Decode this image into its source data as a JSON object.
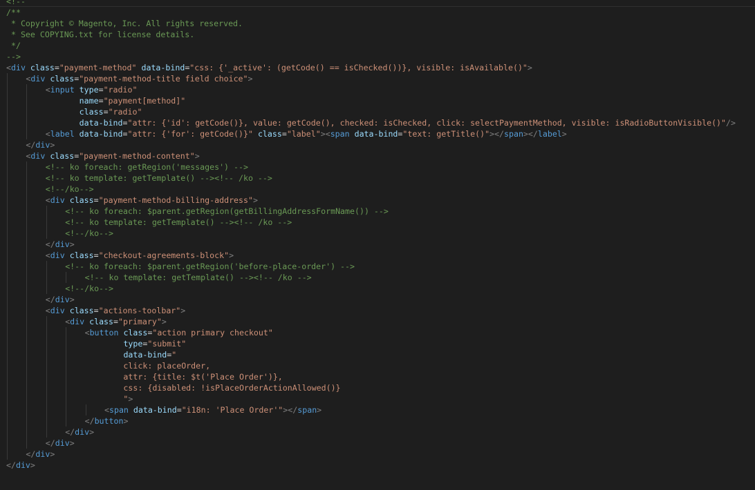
{
  "editor": {
    "colors": {
      "background": "#1e1e1e",
      "comment": "#6a9955",
      "tag": "#569cd6",
      "attribute": "#9cdcfe",
      "string": "#ce9178",
      "punctuation": "#808080",
      "text": "#d4d4d4"
    },
    "lines": [
      {
        "indent": 0,
        "tokens": [
          [
            "c",
            "<!--"
          ]
        ]
      },
      {
        "indent": 0,
        "tokens": [
          [
            "c",
            "/**"
          ]
        ]
      },
      {
        "indent": 0,
        "tokens": [
          [
            "c",
            " * Copyright © Magento, Inc. All rights reserved."
          ]
        ]
      },
      {
        "indent": 0,
        "tokens": [
          [
            "c",
            " * See COPYING.txt for license details."
          ]
        ]
      },
      {
        "indent": 0,
        "tokens": [
          [
            "c",
            " */"
          ]
        ]
      },
      {
        "indent": 0,
        "tokens": [
          [
            "c",
            "-->"
          ]
        ]
      },
      {
        "indent": 0,
        "tokens": [
          [
            "p",
            "<"
          ],
          [
            "t",
            "div"
          ],
          [
            "x",
            " "
          ],
          [
            "a",
            "class"
          ],
          [
            "x",
            "="
          ],
          [
            "s",
            "\"payment-method\""
          ],
          [
            "x",
            " "
          ],
          [
            "a",
            "data-bind"
          ],
          [
            "x",
            "="
          ],
          [
            "s",
            "\"css: {'_active': (getCode() == isChecked())}, visible: isAvailable()\""
          ],
          [
            "p",
            ">"
          ]
        ]
      },
      {
        "indent": 1,
        "tokens": [
          [
            "p",
            "<"
          ],
          [
            "t",
            "div"
          ],
          [
            "x",
            " "
          ],
          [
            "a",
            "class"
          ],
          [
            "x",
            "="
          ],
          [
            "s",
            "\"payment-method-title field choice\""
          ],
          [
            "p",
            ">"
          ]
        ]
      },
      {
        "indent": 2,
        "tokens": [
          [
            "p",
            "<"
          ],
          [
            "t",
            "input"
          ],
          [
            "x",
            " "
          ],
          [
            "a",
            "type"
          ],
          [
            "x",
            "="
          ],
          [
            "s",
            "\"radio\""
          ]
        ]
      },
      {
        "indent": 2,
        "tokens": [
          [
            "x",
            "       "
          ],
          [
            "a",
            "name"
          ],
          [
            "x",
            "="
          ],
          [
            "s",
            "\"payment[method]\""
          ]
        ]
      },
      {
        "indent": 2,
        "tokens": [
          [
            "x",
            "       "
          ],
          [
            "a",
            "class"
          ],
          [
            "x",
            "="
          ],
          [
            "s",
            "\"radio\""
          ]
        ]
      },
      {
        "indent": 2,
        "tokens": [
          [
            "x",
            "       "
          ],
          [
            "a",
            "data-bind"
          ],
          [
            "x",
            "="
          ],
          [
            "s",
            "\"attr: {'id': getCode()}, value: getCode(), checked: isChecked, click: selectPaymentMethod, visible: isRadioButtonVisible()\""
          ],
          [
            "p",
            "/>"
          ]
        ]
      },
      {
        "indent": 2,
        "tokens": [
          [
            "p",
            "<"
          ],
          [
            "t",
            "label"
          ],
          [
            "x",
            " "
          ],
          [
            "a",
            "data-bind"
          ],
          [
            "x",
            "="
          ],
          [
            "s",
            "\"attr: {'for': getCode()}\""
          ],
          [
            "x",
            " "
          ],
          [
            "a",
            "class"
          ],
          [
            "x",
            "="
          ],
          [
            "s",
            "\"label\""
          ],
          [
            "p",
            "><"
          ],
          [
            "t",
            "span"
          ],
          [
            "x",
            " "
          ],
          [
            "a",
            "data-bind"
          ],
          [
            "x",
            "="
          ],
          [
            "s",
            "\"text: getTitle()\""
          ],
          [
            "p",
            "></"
          ],
          [
            "t",
            "span"
          ],
          [
            "p",
            "></"
          ],
          [
            "t",
            "label"
          ],
          [
            "p",
            ">"
          ]
        ]
      },
      {
        "indent": 1,
        "tokens": [
          [
            "p",
            "</"
          ],
          [
            "t",
            "div"
          ],
          [
            "p",
            ">"
          ]
        ]
      },
      {
        "indent": 1,
        "tokens": [
          [
            "p",
            "<"
          ],
          [
            "t",
            "div"
          ],
          [
            "x",
            " "
          ],
          [
            "a",
            "class"
          ],
          [
            "x",
            "="
          ],
          [
            "s",
            "\"payment-method-content\""
          ],
          [
            "p",
            ">"
          ]
        ]
      },
      {
        "indent": 2,
        "tokens": [
          [
            "c",
            "<!-- ko foreach: getRegion('messages') -->"
          ]
        ]
      },
      {
        "indent": 2,
        "tokens": [
          [
            "c",
            "<!-- ko template: getTemplate() --><!-- /ko -->"
          ]
        ]
      },
      {
        "indent": 2,
        "tokens": [
          [
            "c",
            "<!--/ko-->"
          ]
        ]
      },
      {
        "indent": 2,
        "tokens": [
          [
            "p",
            "<"
          ],
          [
            "t",
            "div"
          ],
          [
            "x",
            " "
          ],
          [
            "a",
            "class"
          ],
          [
            "x",
            "="
          ],
          [
            "s",
            "\"payment-method-billing-address\""
          ],
          [
            "p",
            ">"
          ]
        ]
      },
      {
        "indent": 3,
        "tokens": [
          [
            "c",
            "<!-- ko foreach: $parent.getRegion(getBillingAddressFormName()) -->"
          ]
        ]
      },
      {
        "indent": 3,
        "tokens": [
          [
            "c",
            "<!-- ko template: getTemplate() --><!-- /ko -->"
          ]
        ]
      },
      {
        "indent": 3,
        "tokens": [
          [
            "c",
            "<!--/ko-->"
          ]
        ]
      },
      {
        "indent": 2,
        "tokens": [
          [
            "p",
            "</"
          ],
          [
            "t",
            "div"
          ],
          [
            "p",
            ">"
          ]
        ]
      },
      {
        "indent": 2,
        "tokens": [
          [
            "p",
            "<"
          ],
          [
            "t",
            "div"
          ],
          [
            "x",
            " "
          ],
          [
            "a",
            "class"
          ],
          [
            "x",
            "="
          ],
          [
            "s",
            "\"checkout-agreements-block\""
          ],
          [
            "p",
            ">"
          ]
        ]
      },
      {
        "indent": 3,
        "tokens": [
          [
            "c",
            "<!-- ko foreach: $parent.getRegion('before-place-order') -->"
          ]
        ]
      },
      {
        "indent": 4,
        "tokens": [
          [
            "c",
            "<!-- ko template: getTemplate() --><!-- /ko -->"
          ]
        ]
      },
      {
        "indent": 3,
        "tokens": [
          [
            "c",
            "<!--/ko-->"
          ]
        ]
      },
      {
        "indent": 2,
        "tokens": [
          [
            "p",
            "</"
          ],
          [
            "t",
            "div"
          ],
          [
            "p",
            ">"
          ]
        ]
      },
      {
        "indent": 2,
        "tokens": [
          [
            "p",
            "<"
          ],
          [
            "t",
            "div"
          ],
          [
            "x",
            " "
          ],
          [
            "a",
            "class"
          ],
          [
            "x",
            "="
          ],
          [
            "s",
            "\"actions-toolbar\""
          ],
          [
            "p",
            ">"
          ]
        ]
      },
      {
        "indent": 3,
        "tokens": [
          [
            "p",
            "<"
          ],
          [
            "t",
            "div"
          ],
          [
            "x",
            " "
          ],
          [
            "a",
            "class"
          ],
          [
            "x",
            "="
          ],
          [
            "s",
            "\"primary\""
          ],
          [
            "p",
            ">"
          ]
        ]
      },
      {
        "indent": 4,
        "tokens": [
          [
            "p",
            "<"
          ],
          [
            "t",
            "button"
          ],
          [
            "x",
            " "
          ],
          [
            "a",
            "class"
          ],
          [
            "x",
            "="
          ],
          [
            "s",
            "\"action primary checkout\""
          ]
        ]
      },
      {
        "indent": 4,
        "tokens": [
          [
            "x",
            "        "
          ],
          [
            "a",
            "type"
          ],
          [
            "x",
            "="
          ],
          [
            "s",
            "\"submit\""
          ]
        ]
      },
      {
        "indent": 4,
        "tokens": [
          [
            "x",
            "        "
          ],
          [
            "a",
            "data-bind"
          ],
          [
            "x",
            "="
          ],
          [
            "s",
            "\""
          ]
        ]
      },
      {
        "indent": 4,
        "tokens": [
          [
            "s",
            "        click: placeOrder,"
          ]
        ]
      },
      {
        "indent": 4,
        "tokens": [
          [
            "s",
            "        attr: {title: $t('Place Order')},"
          ]
        ]
      },
      {
        "indent": 4,
        "tokens": [
          [
            "s",
            "        css: {disabled: !isPlaceOrderActionAllowed()}"
          ]
        ]
      },
      {
        "indent": 4,
        "tokens": [
          [
            "s",
            "        \""
          ],
          [
            "p",
            ">"
          ]
        ]
      },
      {
        "indent": 5,
        "tokens": [
          [
            "p",
            "<"
          ],
          [
            "t",
            "span"
          ],
          [
            "x",
            " "
          ],
          [
            "a",
            "data-bind"
          ],
          [
            "x",
            "="
          ],
          [
            "s",
            "\"i18n: 'Place Order'\""
          ],
          [
            "p",
            "></"
          ],
          [
            "t",
            "span"
          ],
          [
            "p",
            ">"
          ]
        ]
      },
      {
        "indent": 4,
        "tokens": [
          [
            "p",
            "</"
          ],
          [
            "t",
            "button"
          ],
          [
            "p",
            ">"
          ]
        ]
      },
      {
        "indent": 3,
        "tokens": [
          [
            "p",
            "</"
          ],
          [
            "t",
            "div"
          ],
          [
            "p",
            ">"
          ]
        ]
      },
      {
        "indent": 2,
        "tokens": [
          [
            "p",
            "</"
          ],
          [
            "t",
            "div"
          ],
          [
            "p",
            ">"
          ]
        ]
      },
      {
        "indent": 1,
        "tokens": [
          [
            "p",
            "</"
          ],
          [
            "t",
            "div"
          ],
          [
            "p",
            ">"
          ]
        ]
      },
      {
        "indent": 0,
        "tokens": [
          [
            "p",
            "</"
          ],
          [
            "t",
            "div"
          ],
          [
            "p",
            ">"
          ]
        ]
      }
    ]
  }
}
